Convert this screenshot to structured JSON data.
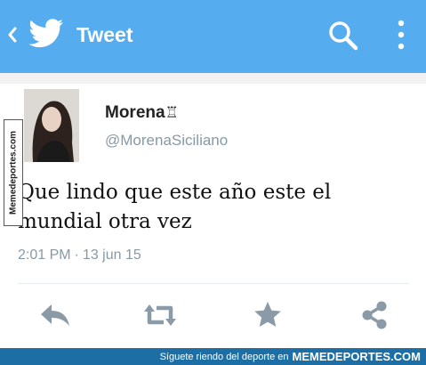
{
  "header": {
    "title": "Tweet",
    "back_icon": "chevron-left-icon",
    "logo_icon": "twitter-bird-icon",
    "search_icon": "search-icon",
    "menu_icon": "overflow-menu-icon",
    "color": "#55acee"
  },
  "tweet": {
    "display_name": "Morena",
    "name_symbol": "♖",
    "handle": "@MorenaSiciliano",
    "text_line1": "Que lindo que este año este el",
    "text_line2": "mundial otra vez",
    "time": "2:01 PM",
    "date": "13 jun 15"
  },
  "actions": [
    {
      "icon": "reply-icon"
    },
    {
      "icon": "retweet-icon"
    },
    {
      "icon": "favorite-star-icon"
    },
    {
      "icon": "share-icon"
    }
  ],
  "watermark": {
    "side_text": "Memedeportes.com",
    "footer_text": "Síguete riendo del deporte en",
    "footer_brand": "MEMEDEPORTES.COM"
  }
}
